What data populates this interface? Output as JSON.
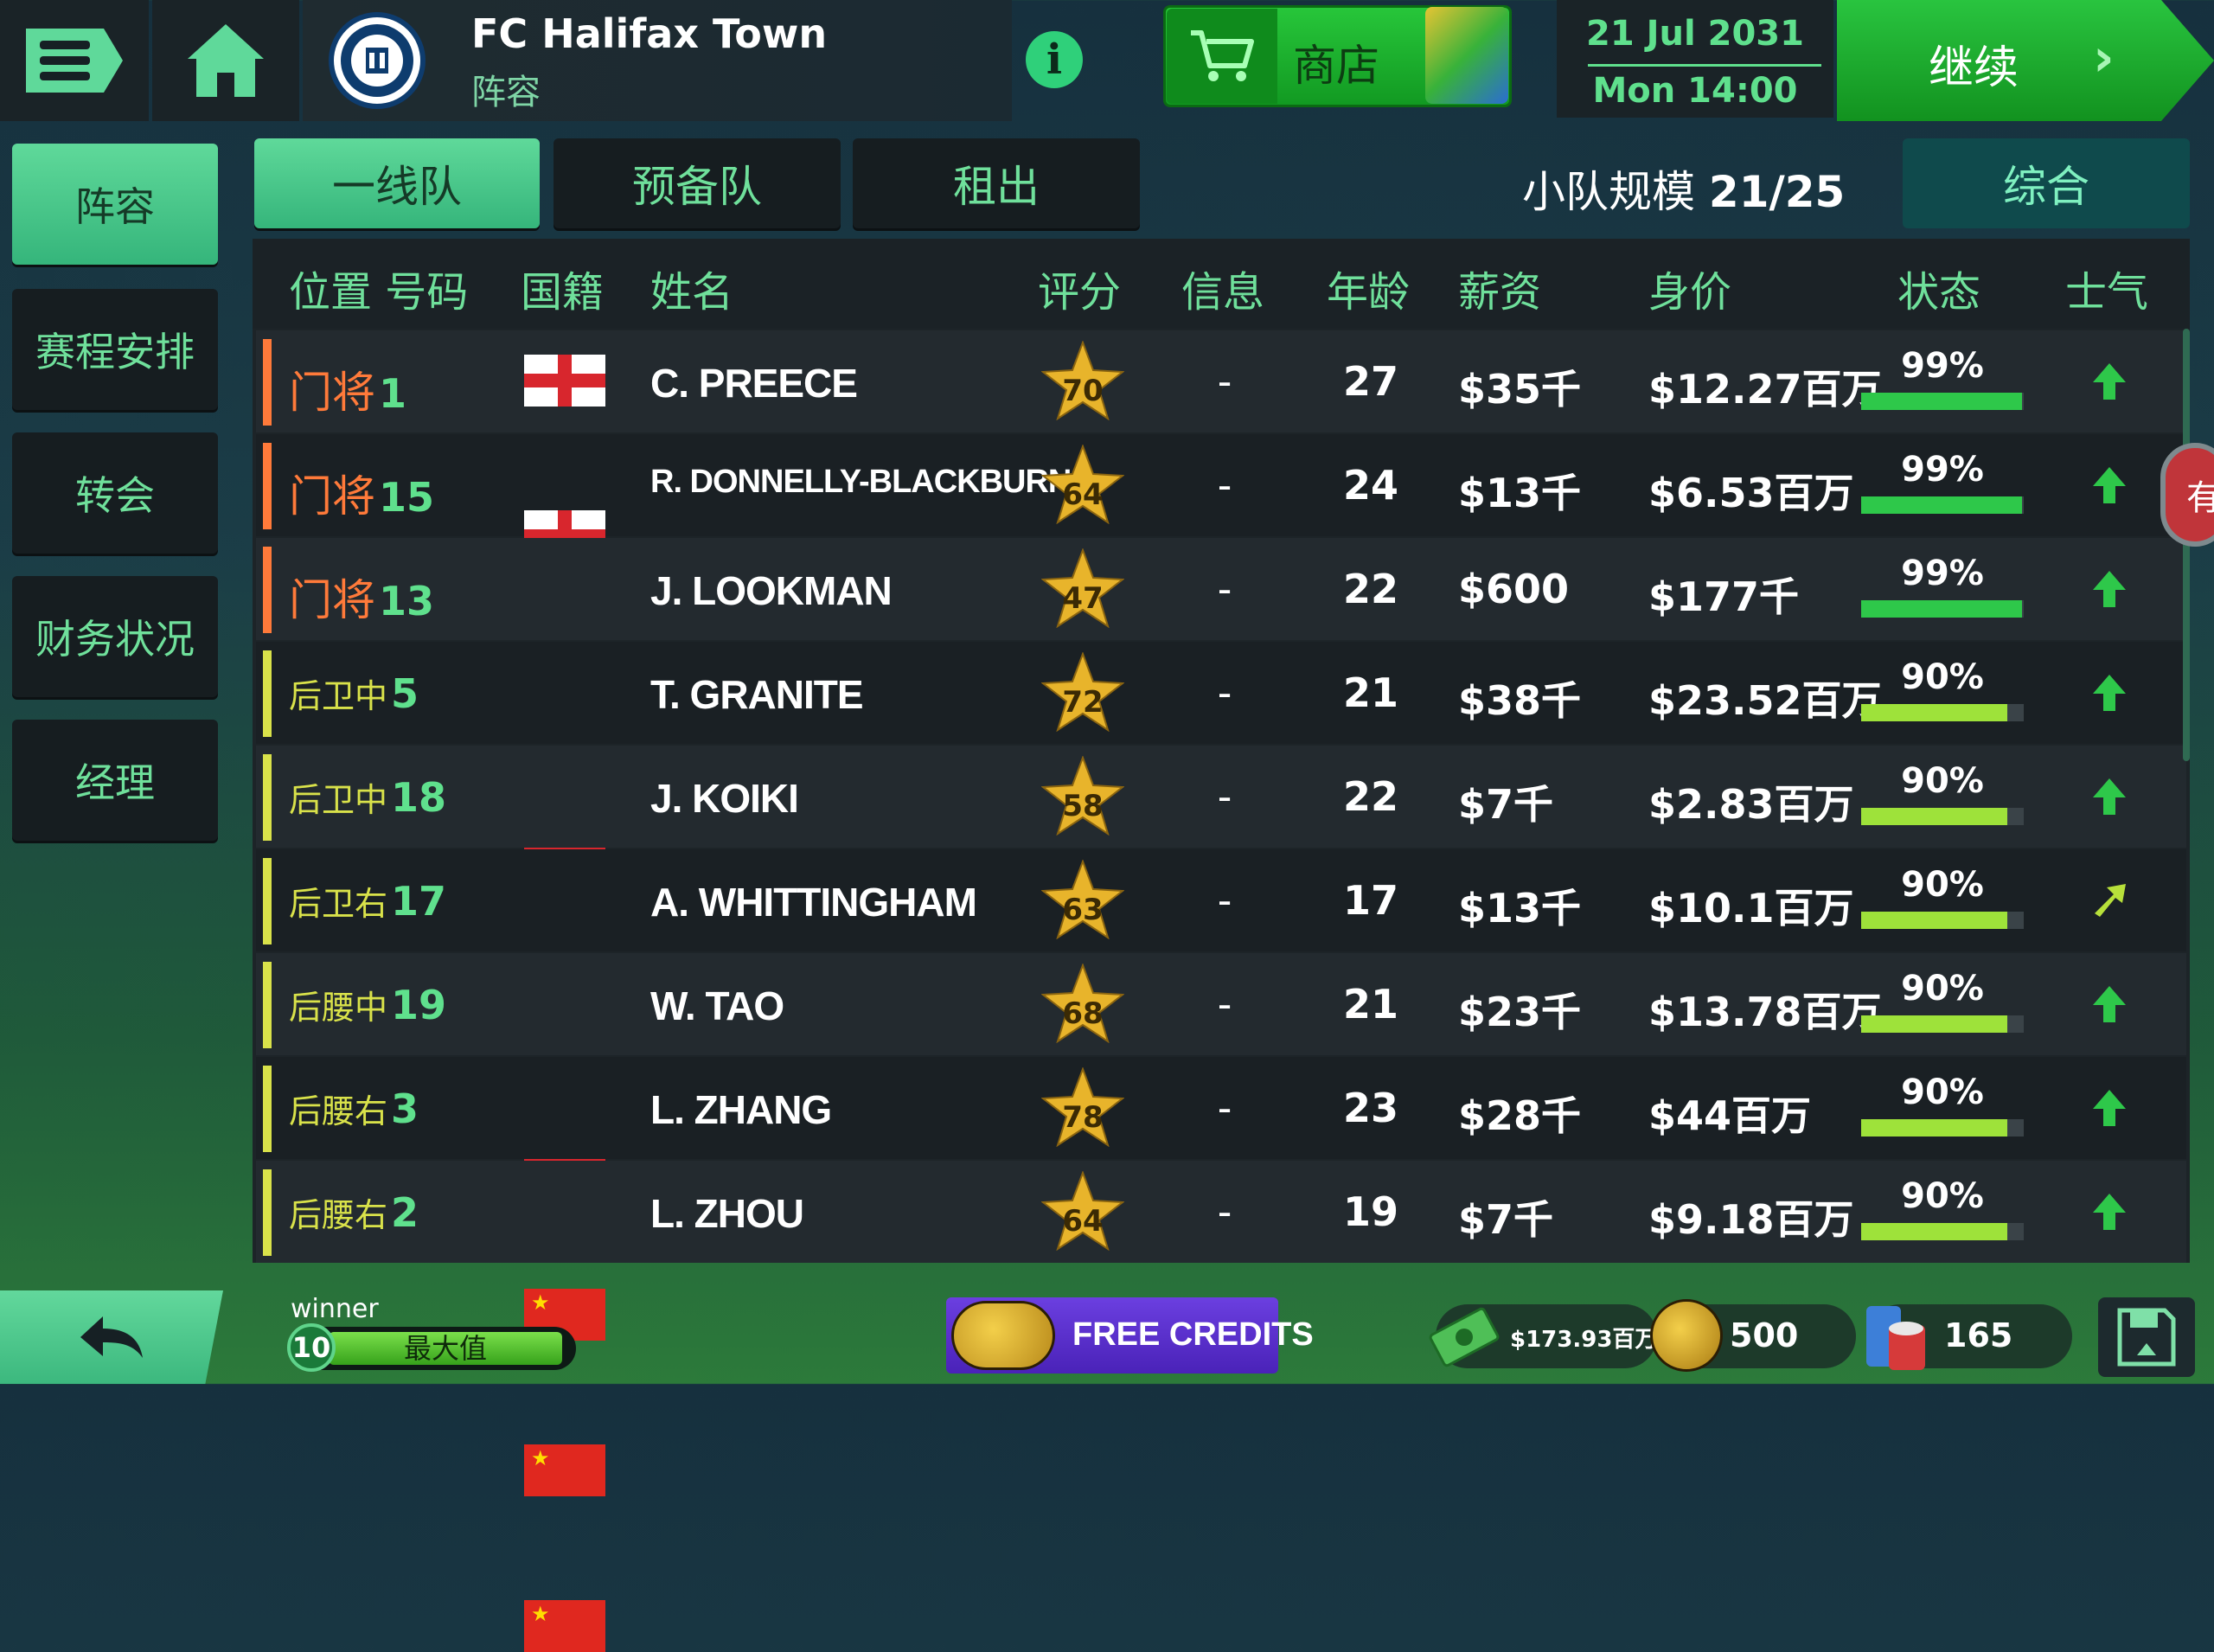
{
  "header": {
    "club_name": "FC Halifax Town",
    "section": "阵容",
    "crest_text": "FC HALIFAX TOWN · THE SHAYMEN",
    "shop_label": "商店",
    "date": "21 Jul 2031",
    "time": "Mon 14:00",
    "continue_label": "继续"
  },
  "sidebar": {
    "items": [
      {
        "label": "阵容",
        "active": true
      },
      {
        "label": "赛程安排",
        "active": false
      },
      {
        "label": "转会",
        "active": false
      },
      {
        "label": "财务状况",
        "active": false
      },
      {
        "label": "经理",
        "active": false
      }
    ]
  },
  "tabs": [
    {
      "label": "一线队",
      "active": true
    },
    {
      "label": "预备队",
      "active": false
    },
    {
      "label": "租出",
      "active": false
    }
  ],
  "squad": {
    "size_label": "小队规模",
    "size_value": "21/25",
    "overall_label": "综合"
  },
  "table": {
    "headers": {
      "position_number": "位置 号码",
      "nationality": "国籍",
      "name": "姓名",
      "rating": "评分",
      "info": "信息",
      "age": "年龄",
      "wage": "薪资",
      "value": "身价",
      "fitness": "状态",
      "morale": "士气"
    },
    "rows": [
      {
        "position": "门将",
        "number": "1",
        "pos_color": "#ff7a3a",
        "flag": "eng",
        "name": "C. PREECE",
        "rating": "70",
        "info": "-",
        "age": "27",
        "wage": "$35千",
        "value": "$12.27百万",
        "fitness_text": "99%",
        "fitness": 0.99,
        "morale": "up"
      },
      {
        "position": "门将",
        "number": "15",
        "pos_color": "#ff7a3a",
        "flag": "eng",
        "name": "R. DONNELLY-BLACKBURN",
        "rating": "64",
        "info": "-",
        "age": "24",
        "wage": "$13千",
        "value": "$6.53百万",
        "fitness_text": "99%",
        "fitness": 0.99,
        "morale": "up"
      },
      {
        "position": "门将",
        "number": "13",
        "pos_color": "#ff7a3a",
        "flag": "eng",
        "name": "J. LOOKMAN",
        "rating": "47",
        "info": "-",
        "age": "22",
        "wage": "$600",
        "value": "$177千",
        "fitness_text": "99%",
        "fitness": 0.99,
        "morale": "up"
      },
      {
        "position": "后卫中",
        "number": "5",
        "pos_color": "#d9e24a",
        "flag": "eng",
        "name": "T. GRANITE",
        "rating": "72",
        "info": "-",
        "age": "21",
        "wage": "$38千",
        "value": "$23.52百万",
        "fitness_text": "90%",
        "fitness": 0.9,
        "morale": "up"
      },
      {
        "position": "后卫中",
        "number": "18",
        "pos_color": "#d9e24a",
        "flag": "eng",
        "name": "J. KOIKI",
        "rating": "58",
        "info": "-",
        "age": "22",
        "wage": "$7千",
        "value": "$2.83百万",
        "fitness_text": "90%",
        "fitness": 0.9,
        "morale": "up"
      },
      {
        "position": "后卫右",
        "number": "17",
        "pos_color": "#d9e24a",
        "flag": "eng",
        "name": "A. WHITTINGHAM",
        "rating": "63",
        "info": "-",
        "age": "17",
        "wage": "$13千",
        "value": "$10.1百万",
        "fitness_text": "90%",
        "fitness": 0.9,
        "morale": "up-right"
      },
      {
        "position": "后腰中",
        "number": "19",
        "pos_color": "#d9e24a",
        "flag": "chn",
        "name": "W. TAO",
        "rating": "68",
        "info": "-",
        "age": "21",
        "wage": "$23千",
        "value": "$13.78百万",
        "fitness_text": "90%",
        "fitness": 0.9,
        "morale": "up"
      },
      {
        "position": "后腰右",
        "number": "3",
        "pos_color": "#d9e24a",
        "flag": "chn",
        "name": "L. ZHANG",
        "rating": "78",
        "info": "-",
        "age": "23",
        "wage": "$28千",
        "value": "$44百万",
        "fitness_text": "90%",
        "fitness": 0.9,
        "morale": "up"
      },
      {
        "position": "后腰右",
        "number": "2",
        "pos_color": "#d9e24a",
        "flag": "chn",
        "name": "L. ZHOU",
        "rating": "64",
        "info": "-",
        "age": "19",
        "wage": "$7千",
        "value": "$9.18百万",
        "fitness_text": "90%",
        "fitness": 0.9,
        "morale": "up"
      }
    ]
  },
  "edge_badge_text": "有",
  "footer": {
    "user_name": "winner",
    "level": "10",
    "level_label": "最大值",
    "free_credits_label": "FREE CREDITS",
    "cash": "$173.93百万",
    "coins": "500",
    "tokens": "165"
  },
  "colors": {
    "accent_green": "#5fd99a",
    "goalkeeper": "#ff7a3a",
    "outfield": "#d9e24a",
    "star_gold": "#e8b42b",
    "fitness_green": "#2ec84a",
    "fitness_lime": "#9ee23a"
  }
}
